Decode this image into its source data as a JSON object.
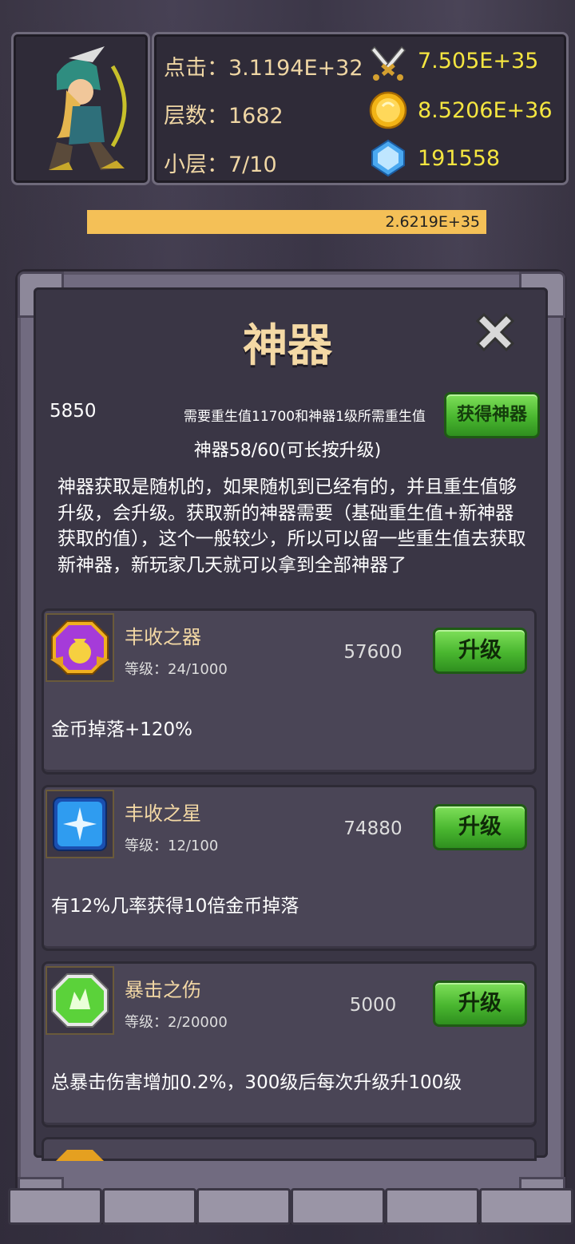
{
  "hud": {
    "click_label": "点击：3.1194E+32",
    "floor_label": "层数：1682",
    "sublevel_label": "小层：7/10",
    "attack_value": "7.505E+35",
    "gold_value": "8.5206E+36",
    "gem_value": "191558",
    "progress_text": "2.6219E+35",
    "icons": [
      "swords-icon",
      "gold-coin-icon",
      "diamond-icon"
    ]
  },
  "dialog": {
    "title": "神器",
    "rebirth_value": "5850",
    "requirement_text": "需要重生值11700和神器1级所需重生值",
    "acquire_button": "获得神器",
    "artifact_progress": "神器58/60(可长按升级)",
    "description": "神器获取是随机的，如果随机到已经有的，并且重生值够升级，会升级。获取新的神器需要（基础重生值+新神器获取的值），这个一般较少，所以可以留一些重生值去获取新神器，新玩家几天就可以拿到全部神器了"
  },
  "artifacts": [
    {
      "name": "丰收之器",
      "level": "等级：24/1000",
      "cost": "57600",
      "button": "升级",
      "effect": "金币掉落+120%",
      "icon": "bag-icon"
    },
    {
      "name": "丰收之星",
      "level": "等级：12/100",
      "cost": "74880",
      "button": "升级",
      "effect": "有12%几率获得10倍金币掉落",
      "icon": "star-icon"
    },
    {
      "name": "暴击之伤",
      "level": "等级：2/20000",
      "cost": "5000",
      "button": "升级",
      "effect": "总暴击伤害增加0.2%，300级后每次升级升100级",
      "icon": "crit-icon"
    }
  ],
  "colors": {
    "accent_text": "#f4d9a5",
    "resource_text": "#f5e640",
    "button_green": "#49b62f",
    "progress_bar": "#f4c057"
  }
}
